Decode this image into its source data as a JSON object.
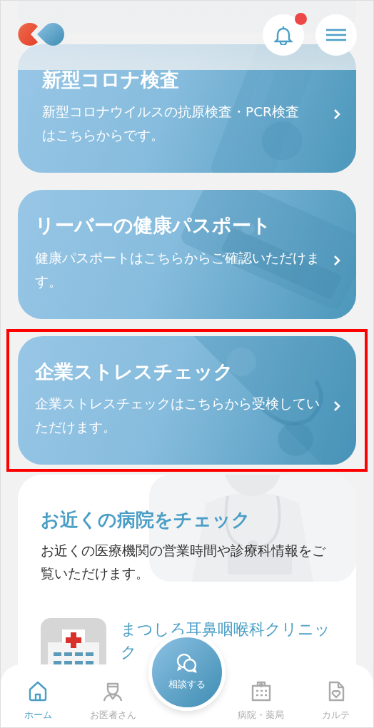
{
  "header": {
    "notification": {
      "unread": true
    }
  },
  "service_cards": [
    {
      "title": "新型コロナ検査",
      "description": "新型コロナウイルスの抗原検査・PCR検査はこちらからです。",
      "highlighted": false
    },
    {
      "title": "リーバーの健康パスポート",
      "description": "健康パスポートはこちらからご確認いただけます。",
      "highlighted": false
    },
    {
      "title": "企業ストレスチェック",
      "description": "企業ストレスチェックはこちらから受検していただけます。",
      "highlighted": true
    }
  ],
  "nearby": {
    "title": "お近くの病院をチェック",
    "description": "お近くの医療機関の営業時間や診療科情報をご覧いただけます。",
    "clinics": [
      {
        "name": "まつしろ耳鼻咽喉科クリニック"
      }
    ]
  },
  "consult_button": {
    "label": "相談する"
  },
  "tab_bar": [
    {
      "label": "ホーム",
      "selected": true,
      "kind": "home"
    },
    {
      "label": "お医者さん",
      "selected": false,
      "kind": "doctor"
    },
    {
      "label": "病院・薬局",
      "selected": false,
      "kind": "hospital"
    },
    {
      "label": "カルテ",
      "selected": false,
      "kind": "record"
    }
  ]
}
